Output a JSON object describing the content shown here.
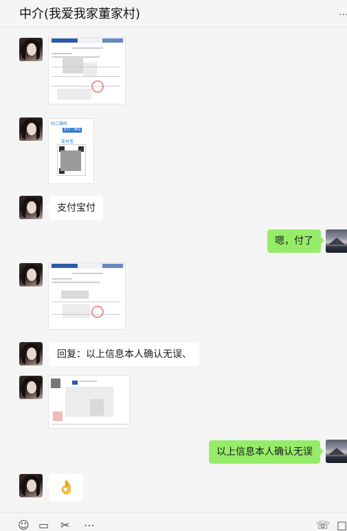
{
  "header": {
    "title": "中介(我爱我家董家村)",
    "more_icon": "…"
  },
  "messages": {
    "m3_text": "支付宝付",
    "m4_text": "嗯，付了",
    "m6_text": "回复：以上信息本人确认无误、",
    "m8_text": "以上信息本人确认无误",
    "m9_emoji": "👌"
  },
  "qr_card": {
    "header_label": "扫二维码",
    "button_label": "支付二维码",
    "brand": "支付宝"
  },
  "toolbar": {
    "emoji": "☺",
    "folder": "▭",
    "scissors": "✂",
    "chat": "⋯",
    "phone": "☏",
    "window": "□"
  },
  "colors": {
    "bubble_right": "#95ec69",
    "bubble_left": "#ffffff",
    "background": "#f5f5f5"
  }
}
